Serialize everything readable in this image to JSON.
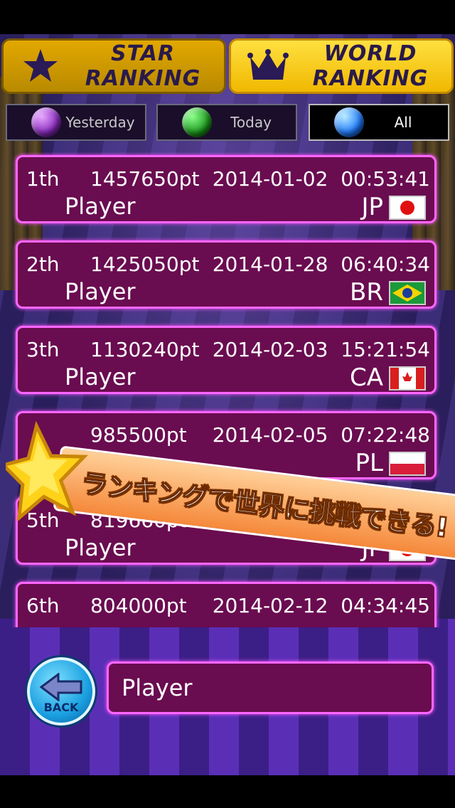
{
  "tabs": {
    "star_ranking": "STAR RANKING",
    "world_ranking": "WORLD RANKING"
  },
  "filters": {
    "yesterday": "Yesterday",
    "today": "Today",
    "all": "All"
  },
  "rows": [
    {
      "rank": "1th",
      "score": "1457650pt",
      "date": "2014-01-02",
      "time": "00:53:41",
      "name": "Player",
      "country": "JP"
    },
    {
      "rank": "2th",
      "score": "1425050pt",
      "date": "2014-01-28",
      "time": "06:40:34",
      "name": "Player",
      "country": "BR"
    },
    {
      "rank": "3th",
      "score": "1130240pt",
      "date": "2014-02-03",
      "time": "15:21:54",
      "name": "Player",
      "country": "CA"
    },
    {
      "rank": "",
      "score": "985500pt",
      "date": "2014-02-05",
      "time": "07:22:48",
      "name": "",
      "country": "PL"
    },
    {
      "rank": "5th",
      "score": "819660pt",
      "date": "2014-0",
      "time": "",
      "name": "Player",
      "country": "JP"
    },
    {
      "rank": "6th",
      "score": "804000pt",
      "date": "2014-02-12",
      "time": "04:34:45",
      "name": "",
      "country": ""
    }
  ],
  "banner": {
    "text": "ランキングで世界に挑戦できる!"
  },
  "bottom": {
    "back_label": "BACK",
    "player_name": "Player"
  },
  "colors": {
    "row_bg": "#6a0c50",
    "row_border": "#ff66ff",
    "tab_gold": "#f0b800"
  }
}
